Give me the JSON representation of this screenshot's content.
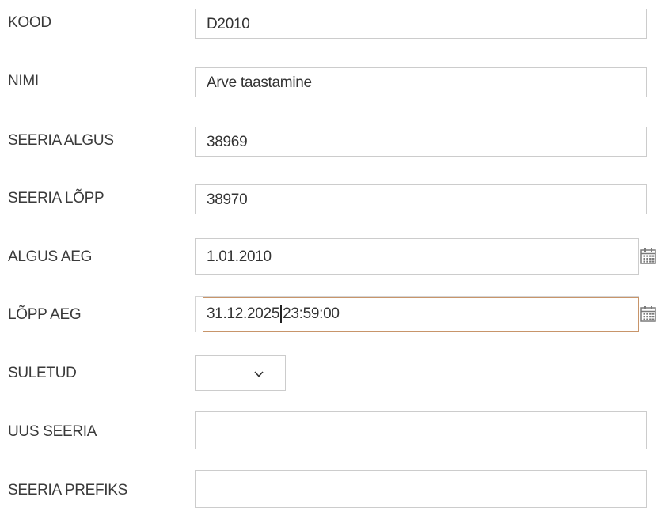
{
  "form": {
    "rows": [
      {
        "label": "KOOD",
        "value": "D2010"
      },
      {
        "label": "NIMI",
        "value": "Arve taastamine"
      },
      {
        "label": "SEERIA ALGUS",
        "value": "38969"
      },
      {
        "label": "SEERIA LÕPP",
        "value": "38970"
      },
      {
        "label": "ALGUS AEG",
        "value": "1.01.2010"
      },
      {
        "label": "LÕPP AEG",
        "value_date": "31.12.2025",
        "value_time": "23:59:00"
      },
      {
        "label": "SULETUD",
        "value": ""
      },
      {
        "label": "UUS SEERIA",
        "value": ""
      },
      {
        "label": "SEERIA PREFIKS",
        "value": ""
      }
    ]
  },
  "icons": {
    "calendar": "calendar-icon",
    "dropdown": "chevron-down-icon"
  },
  "colors": {
    "border": "#cccccc",
    "focus_border": "#c8956a",
    "text": "#333333"
  }
}
